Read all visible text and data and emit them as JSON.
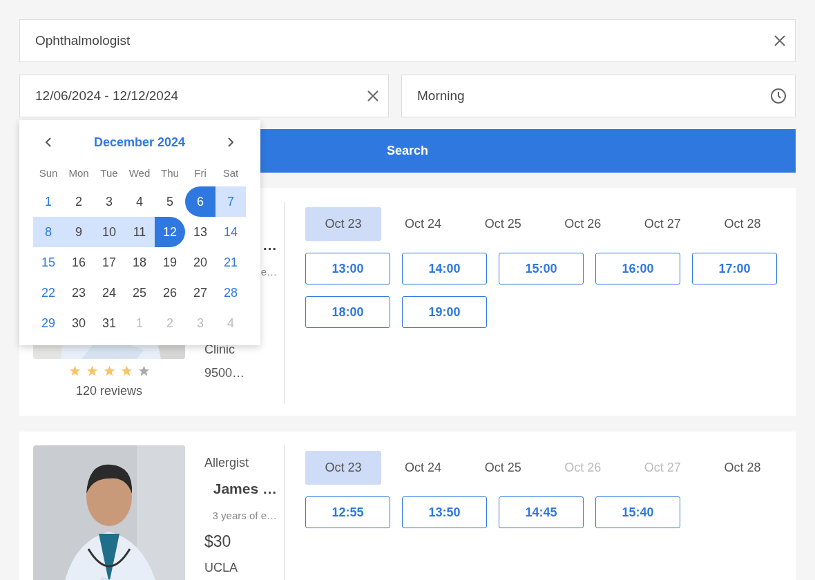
{
  "search": {
    "value": "Ophthalmologist"
  },
  "date_range": {
    "value": "12/06/2024 - 12/12/2024"
  },
  "time_of_day": {
    "value": "Morning"
  },
  "search_button": {
    "label": "Search"
  },
  "calendar": {
    "month": "December 2024",
    "weekdays": [
      "Sun",
      "Mon",
      "Tue",
      "Wed",
      "Thu",
      "Fri",
      "Sat"
    ],
    "weeks": [
      [
        {
          "label": "1",
          "muted": false,
          "selected": false,
          "in_range": false
        },
        {
          "label": "2",
          "muted": false,
          "selected": false,
          "in_range": false
        },
        {
          "label": "3",
          "muted": false,
          "selected": false,
          "in_range": false
        },
        {
          "label": "4",
          "muted": false,
          "selected": false,
          "in_range": false
        },
        {
          "label": "5",
          "muted": false,
          "selected": false,
          "in_range": false
        },
        {
          "label": "6",
          "muted": false,
          "selected": true,
          "in_range": false
        },
        {
          "label": "7",
          "muted": false,
          "selected": false,
          "in_range": true
        }
      ],
      [
        {
          "label": "8",
          "muted": false,
          "selected": false,
          "in_range": true
        },
        {
          "label": "9",
          "muted": false,
          "selected": false,
          "in_range": true
        },
        {
          "label": "10",
          "muted": false,
          "selected": false,
          "in_range": true
        },
        {
          "label": "11",
          "muted": false,
          "selected": false,
          "in_range": true
        },
        {
          "label": "12",
          "muted": false,
          "selected": true,
          "in_range": false
        },
        {
          "label": "13",
          "muted": false,
          "selected": false,
          "in_range": false
        },
        {
          "label": "14",
          "muted": false,
          "selected": false,
          "in_range": false
        }
      ],
      [
        {
          "label": "15",
          "muted": false,
          "selected": false,
          "in_range": false
        },
        {
          "label": "16",
          "muted": false,
          "selected": false,
          "in_range": false
        },
        {
          "label": "17",
          "muted": false,
          "selected": false,
          "in_range": false
        },
        {
          "label": "18",
          "muted": false,
          "selected": false,
          "in_range": false
        },
        {
          "label": "19",
          "muted": false,
          "selected": false,
          "in_range": false
        },
        {
          "label": "20",
          "muted": false,
          "selected": false,
          "in_range": false
        },
        {
          "label": "21",
          "muted": false,
          "selected": false,
          "in_range": false
        }
      ],
      [
        {
          "label": "22",
          "muted": false,
          "selected": false,
          "in_range": false
        },
        {
          "label": "23",
          "muted": false,
          "selected": false,
          "in_range": false
        },
        {
          "label": "24",
          "muted": false,
          "selected": false,
          "in_range": false
        },
        {
          "label": "25",
          "muted": false,
          "selected": false,
          "in_range": false
        },
        {
          "label": "26",
          "muted": false,
          "selected": false,
          "in_range": false
        },
        {
          "label": "27",
          "muted": false,
          "selected": false,
          "in_range": false
        },
        {
          "label": "28",
          "muted": false,
          "selected": false,
          "in_range": false
        }
      ],
      [
        {
          "label": "29",
          "muted": false,
          "selected": false,
          "in_range": false
        },
        {
          "label": "30",
          "muted": false,
          "selected": false,
          "in_range": false
        },
        {
          "label": "31",
          "muted": false,
          "selected": false,
          "in_range": false
        },
        {
          "label": "1",
          "muted": true,
          "selected": false,
          "in_range": false
        },
        {
          "label": "2",
          "muted": true,
          "selected": false,
          "in_range": false
        },
        {
          "label": "3",
          "muted": true,
          "selected": false,
          "in_range": false
        },
        {
          "label": "4",
          "muted": true,
          "selected": false,
          "in_range": false
        }
      ]
    ]
  },
  "doctors": [
    {
      "photo": {
        "kind": "picture"
      },
      "stars": 4,
      "reviews": "120 reviews",
      "info": [
        {
          "kind": "name",
          "text": "…"
        },
        {
          "kind": "experience",
          "text": "e…"
        },
        {
          "kind": "clinic",
          "text": "Clinic"
        },
        {
          "kind": "address",
          "text": "9500…"
        }
      ],
      "dates": [
        {
          "label": "Oct 23",
          "selected": true,
          "disabled": false
        },
        {
          "label": "Oct 24",
          "selected": false,
          "disabled": false
        },
        {
          "label": "Oct 25",
          "selected": false,
          "disabled": false
        },
        {
          "label": "Oct 26",
          "selected": false,
          "disabled": false
        },
        {
          "label": "Oct 27",
          "selected": false,
          "disabled": false
        },
        {
          "label": "Oct 28",
          "selected": false,
          "disabled": false
        }
      ],
      "slots": [
        "13:00",
        "14:00",
        "15:00",
        "16:00",
        "17:00",
        "18:00",
        "19:00"
      ]
    },
    {
      "photo": {
        "kind": "picture"
      },
      "info": [
        {
          "kind": "specialty",
          "text": "Allergist"
        },
        {
          "kind": "name",
          "text": "James …"
        },
        {
          "kind": "experience",
          "text": "3 years of e…"
        },
        {
          "kind": "price",
          "text": "$30"
        },
        {
          "kind": "school",
          "text": "UCLA"
        }
      ],
      "dates": [
        {
          "label": "Oct 23",
          "selected": true,
          "disabled": false
        },
        {
          "label": "Oct 24",
          "selected": false,
          "disabled": false
        },
        {
          "label": "Oct 25",
          "selected": false,
          "disabled": false
        },
        {
          "label": "Oct 26",
          "selected": false,
          "disabled": true
        },
        {
          "label": "Oct 27",
          "selected": false,
          "disabled": true
        },
        {
          "label": "Oct 28",
          "selected": false,
          "disabled": false
        }
      ],
      "slots": [
        "12:55",
        "13:50",
        "14:45",
        "15:40"
      ]
    }
  ]
}
